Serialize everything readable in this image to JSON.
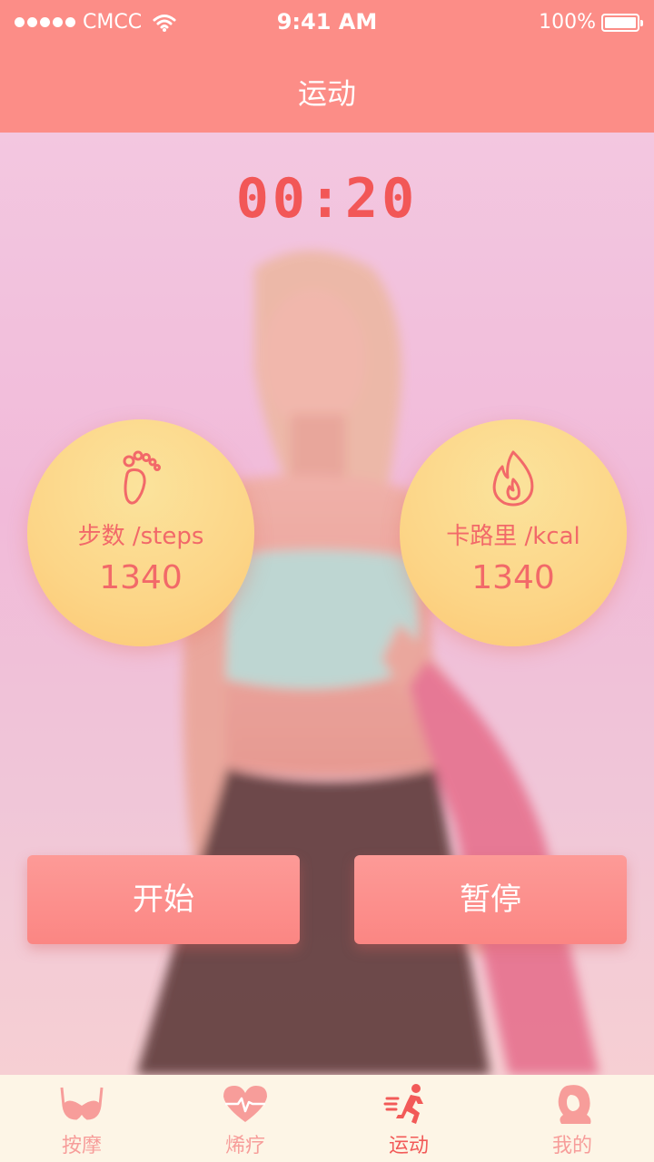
{
  "status_bar": {
    "carrier": "CMCC",
    "time": "9:41 AM",
    "battery": "100%"
  },
  "header": {
    "title": "运动"
  },
  "timer": {
    "value": "00:20"
  },
  "stats": {
    "steps": {
      "label": "步数 /steps",
      "value": "1340",
      "icon": "footprint-icon"
    },
    "calories": {
      "label": "卡路里 /kcal",
      "value": "1340",
      "icon": "flame-icon"
    }
  },
  "buttons": {
    "start": "开始",
    "pause": "暂停"
  },
  "tab_bar": {
    "items": [
      {
        "label": "按摩",
        "icon": "bra-icon",
        "active": false
      },
      {
        "label": "烯疗",
        "icon": "heartbeat-icon",
        "active": false
      },
      {
        "label": "运动",
        "icon": "running-icon",
        "active": true
      },
      {
        "label": "我的",
        "icon": "woman-profile-icon",
        "active": false
      }
    ]
  },
  "colors": {
    "header": "#fc8d87",
    "accent": "#f25757",
    "circle": "#fcd587",
    "button": "#fb8683",
    "tab_bar": "#fdf5e6"
  }
}
